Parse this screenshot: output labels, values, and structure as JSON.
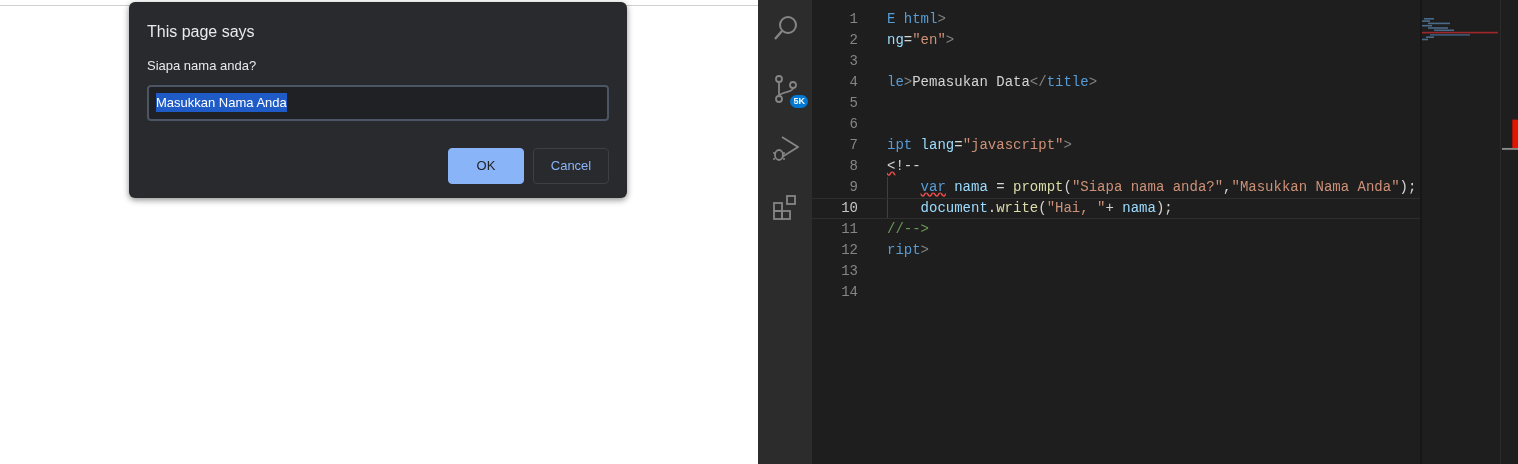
{
  "dialog": {
    "title": "This page says",
    "message": "Siapa nama anda?",
    "input": {
      "value": "Masukkan Nama Anda",
      "selected": true
    },
    "buttons": [
      {
        "label": "OK",
        "kind": "primary"
      },
      {
        "label": "Cancel",
        "kind": "secondary"
      }
    ]
  },
  "activity_bar": [
    {
      "kind": "search"
    },
    {
      "kind": "source-control",
      "badge": "5K"
    },
    {
      "kind": "run-debug"
    },
    {
      "kind": "extensions"
    }
  ],
  "editor": {
    "lines": [
      {
        "number": "1",
        "current": false,
        "guide": false,
        "tokens": [
          {
            "text": "E html",
            "kind": "tag"
          },
          {
            "text": ">",
            "kind": "punct"
          }
        ]
      },
      {
        "number": "2",
        "current": false,
        "guide": false,
        "tokens": [
          {
            "text": "ng",
            "kind": "attr"
          },
          {
            "text": "=",
            "kind": "text"
          },
          {
            "text": "\"en\"",
            "kind": "string"
          },
          {
            "text": ">",
            "kind": "punct"
          }
        ]
      },
      {
        "number": "3",
        "current": false,
        "guide": false
      },
      {
        "number": "4",
        "current": false,
        "guide": false,
        "tokens": [
          {
            "text": "le",
            "kind": "tag"
          },
          {
            "text": ">",
            "kind": "punct"
          },
          {
            "text": "Pemasukan Data",
            "kind": "text"
          },
          {
            "text": "</",
            "kind": "punct"
          },
          {
            "text": "title",
            "kind": "tag"
          },
          {
            "text": ">",
            "kind": "punct"
          }
        ]
      },
      {
        "number": "5",
        "current": false,
        "guide": false
      },
      {
        "number": "6",
        "current": false,
        "guide": false
      },
      {
        "number": "7",
        "current": false,
        "guide": false,
        "tokens": [
          {
            "text": "ipt ",
            "kind": "tag"
          },
          {
            "text": "lang",
            "kind": "attr"
          },
          {
            "text": "=",
            "kind": "text"
          },
          {
            "text": "\"javascript\"",
            "kind": "string"
          },
          {
            "text": ">",
            "kind": "punct"
          }
        ]
      },
      {
        "number": "8",
        "current": false,
        "guide": false,
        "tokens": [
          {
            "text": "<",
            "kind": "text",
            "error": true
          },
          {
            "text": "!--",
            "kind": "text"
          }
        ]
      },
      {
        "number": "9",
        "current": false,
        "guide": true,
        "tokens": [
          {
            "text": "var",
            "kind": "keyword",
            "error": true
          },
          {
            "text": " nama",
            "kind": "variable"
          },
          {
            "text": " = ",
            "kind": "text"
          },
          {
            "text": "prompt",
            "kind": "function"
          },
          {
            "text": "(",
            "kind": "text"
          },
          {
            "text": "\"Siapa nama anda?\"",
            "kind": "string"
          },
          {
            "text": ",",
            "kind": "text"
          },
          {
            "text": "\"Masukkan Nama Anda\"",
            "kind": "string"
          },
          {
            "text": ");",
            "kind": "text"
          }
        ]
      },
      {
        "number": "10",
        "current": true,
        "guide": true,
        "tokens": [
          {
            "text": "document",
            "kind": "variable"
          },
          {
            "text": ".",
            "kind": "text"
          },
          {
            "text": "write",
            "kind": "function"
          },
          {
            "text": "(",
            "kind": "text"
          },
          {
            "text": "\"Hai, \"",
            "kind": "string"
          },
          {
            "text": "+ ",
            "kind": "text"
          },
          {
            "text": "nama",
            "kind": "variable"
          },
          {
            "text": ");",
            "kind": "text"
          }
        ]
      },
      {
        "number": "11",
        "current": false,
        "guide": false,
        "tokens": [
          {
            "text": "//-->",
            "kind": "comment"
          }
        ]
      },
      {
        "number": "12",
        "current": false,
        "guide": false,
        "tokens": [
          {
            "text": "ript",
            "kind": "tag"
          },
          {
            "text": ">",
            "kind": "punct"
          }
        ]
      },
      {
        "number": "13",
        "current": false,
        "guide": false
      },
      {
        "number": "14",
        "current": false,
        "guide": false
      }
    ]
  }
}
